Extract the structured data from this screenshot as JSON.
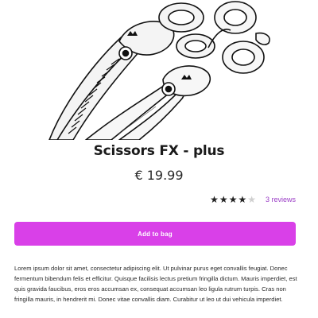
{
  "product": {
    "image_alt": "Scissors FX - plus product image",
    "title": "Scissors FX - plus",
    "price": "€ 19.99",
    "rating": {
      "value": 4,
      "max": 5
    },
    "reviews_label": "3 reviews",
    "add_to_bag_label": "Add to bag",
    "description": "Lorem ipsum dolor sit amet, consectetur adipiscing elit. Ut pulvinar purus eget convallis feugiat. Donec fermentum bibendum felis et efficitur. Quisque facilisis lectus pretium fringilla dictum. Mauris imperdiet, est quis gravida faucibus, eros eros accumsan ex, consequat accumsan leo ligula rutrum turpis. Cras non fringilla mauris, in hendrerit mi. Donec vitae convallis diam. Curabitur ut leo ut dui vehicula imperdiet."
  },
  "colors": {
    "accent": "#d940e8",
    "link": "#9b3ec6",
    "star_filled": "#222222",
    "star_empty": "#cfcfcf"
  }
}
